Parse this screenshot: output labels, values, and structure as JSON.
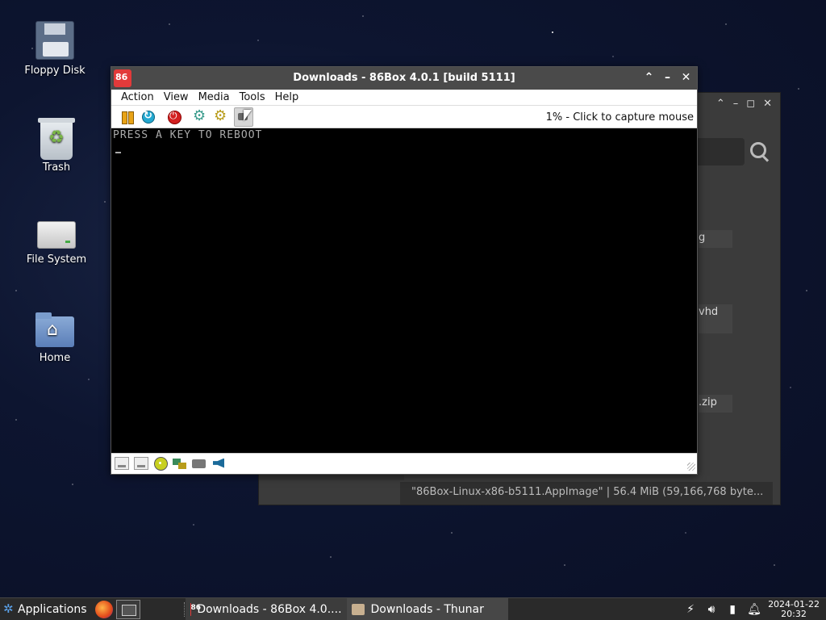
{
  "desktop": {
    "icons": [
      {
        "label": "Floppy Disk",
        "icon": "floppy-disk-icon"
      },
      {
        "label": "Trash",
        "icon": "trash-icon"
      },
      {
        "label": "File System",
        "icon": "drive-icon"
      },
      {
        "label": "Home",
        "icon": "home-folder-icon"
      }
    ]
  },
  "thunar": {
    "file_fragments": [
      "g",
      "vhd",
      ".zip"
    ],
    "status_text": "\"86Box-Linux-x86-b5111.AppImage\"  |  56.4 MiB (59,166,768 byte..."
  },
  "box86": {
    "title": "Downloads - 86Box 4.0.1 [build 5111]",
    "menu": [
      "Action",
      "View",
      "Media",
      "Tools",
      "Help"
    ],
    "capture_text": "1% - Click to capture mouse",
    "screen_text": "PRESS A KEY TO REBOOT"
  },
  "taskbar": {
    "applications_label": "Applications",
    "tasks": [
      {
        "label": "Downloads - 86Box 4.0....",
        "active": true
      },
      {
        "label": "Downloads - Thunar",
        "active": false
      }
    ],
    "clock_date": "2024-01-22",
    "clock_time": "20:32"
  },
  "colors": {
    "accent_86box": "#e23a3a",
    "titlebar": "#4a4a4a",
    "taskbar": "#2a2a2a"
  }
}
